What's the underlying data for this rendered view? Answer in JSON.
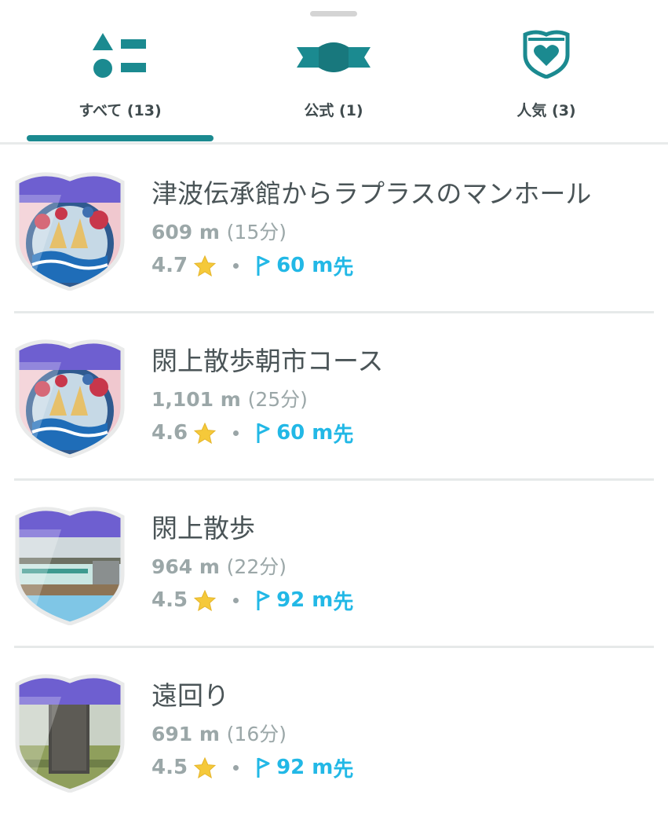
{
  "tabs": [
    {
      "label": "すべて (13)",
      "icon": "shapes-icon",
      "selected": true
    },
    {
      "label": "公式 (1)",
      "icon": "official-route-icon",
      "selected": false
    },
    {
      "label": "人気 (3)",
      "icon": "heart-shield-icon",
      "selected": false
    }
  ],
  "colors": {
    "accent": "#1b8a90",
    "badge_purple": "#6e5fd0",
    "link_blue": "#22b8e6",
    "star": "#f5c93a",
    "text_dark": "#4a5457",
    "text_muted": "#9ba7a8"
  },
  "routes": [
    {
      "name": "津波伝承館からラプラスのマンホール",
      "distance": "609 m",
      "duration": "(15分)",
      "rating": "4.7",
      "start_distance": "60 m",
      "start_suffix": "先",
      "thumbnail": "manhole-art"
    },
    {
      "name": "閖上散歩朝市コース",
      "distance": "1,101 m",
      "duration": "(25分)",
      "rating": "4.6",
      "start_distance": "60 m",
      "start_suffix": "先",
      "thumbnail": "manhole-art"
    },
    {
      "name": "閖上散歩",
      "distance": "964 m",
      "duration": "(22分)",
      "rating": "4.5",
      "start_distance": "92 m",
      "start_suffix": "先",
      "thumbnail": "riverside-photo"
    },
    {
      "name": "遠回り",
      "distance": "691 m",
      "duration": "(16分)",
      "rating": "4.5",
      "start_distance": "92 m",
      "start_suffix": "先",
      "thumbnail": "stone-monument-photo"
    }
  ]
}
